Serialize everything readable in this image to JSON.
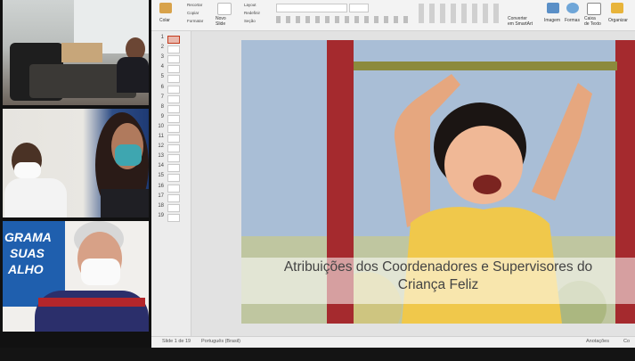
{
  "ribbon": {
    "buttons": {
      "colar": "Colar",
      "recortar": "Recortar",
      "copiar": "Copiar",
      "formatar": "Formatar",
      "novo_slide": "Novo\nSlide",
      "layout": "Layout",
      "redefinir": "Redefinir",
      "secao": "Seção",
      "converter": "Converter\nem SmartArt",
      "imagem": "Imagem",
      "formas": "Formas",
      "caixa_texto": "Caixa\nde Texto",
      "organizar": "Organizar"
    }
  },
  "thumbnails": [
    "1",
    "2",
    "3",
    "4",
    "5",
    "6",
    "7",
    "8",
    "9",
    "10",
    "11",
    "12",
    "13",
    "14",
    "15",
    "16",
    "17",
    "18",
    "19"
  ],
  "slide": {
    "title_line1": "Atribuições dos Coordenadores e Supervisores do",
    "title_line2": "Criança Feliz"
  },
  "statusbar": {
    "slide_count": "Slide 1 de 19",
    "language": "Português (Brasil)",
    "notes": "Anotações",
    "comments": "Co"
  },
  "participants": {
    "banner_lines": [
      "GRAMA",
      "SUAS",
      "ALHO"
    ]
  },
  "colors": {
    "slide_title": "#444444",
    "banner_blue": "#1f5fae",
    "bar_red": "#b3262b"
  }
}
